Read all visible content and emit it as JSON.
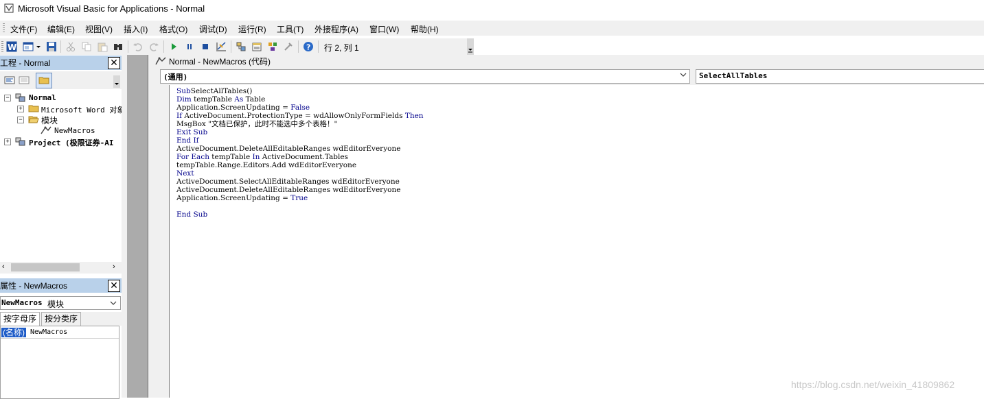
{
  "window": {
    "title": "Microsoft Visual Basic for Applications - Normal"
  },
  "menu": [
    "文件(F)",
    "编辑(E)",
    "视图(V)",
    "插入(I)",
    "格式(O)",
    "调试(D)",
    "运行(R)",
    "工具(T)",
    "外接程序(A)",
    "窗口(W)",
    "帮助(H)"
  ],
  "toolbar": {
    "icons": [
      "word-icon",
      "insert-userform-icon",
      "save-icon",
      "cut-icon",
      "copy-icon",
      "paste-icon",
      "find-icon",
      "undo-icon",
      "redo-icon",
      "run-icon",
      "break-icon",
      "reset-icon",
      "design-mode-icon",
      "project-explorer-icon",
      "properties-window-icon",
      "object-browser-icon",
      "toolbox-icon",
      "help-icon"
    ],
    "position": "行 2, 列 1"
  },
  "project": {
    "title": "工程 - Normal",
    "tree": {
      "root": "Normal",
      "word_objects": "Microsoft Word 对象",
      "modules": "模块",
      "module": "NewMacros",
      "project2": "Project (极限证券-AI"
    }
  },
  "properties": {
    "title": "属性 - NewMacros",
    "object_bold": "NewMacros",
    "object_type": " 模块",
    "tabs": [
      "按字母序",
      "按分类序"
    ],
    "row": {
      "name": "(名称)",
      "value": "NewMacros"
    }
  },
  "code_window": {
    "title": "Normal - NewMacros (代码)",
    "object_combo": "(通用)",
    "proc_combo": "SelectAllTables",
    "lines": [
      [
        [
          "kw",
          "Sub"
        ],
        [
          "",
          "SelectAllTables()"
        ]
      ],
      [
        [
          "kw",
          "Dim"
        ],
        [
          "",
          " tempTable "
        ],
        [
          "kw",
          "As"
        ],
        [
          "",
          " Table"
        ]
      ],
      [
        [
          "",
          "Application.ScreenUpdating = "
        ],
        [
          "kw",
          "False"
        ]
      ],
      [
        [
          "kw",
          "If"
        ],
        [
          "",
          " ActiveDocument.ProtectionType = wdAllowOnlyFormFields "
        ],
        [
          "kw",
          "Then"
        ]
      ],
      [
        [
          "",
          "MsgBox \"文档已保护，此时不能选中多个表格！\""
        ]
      ],
      [
        [
          "kw",
          "Exit Sub"
        ]
      ],
      [
        [
          "kw",
          "End If"
        ]
      ],
      [
        [
          "",
          "ActiveDocument.DeleteAllEditableRanges wdEditorEveryone"
        ]
      ],
      [
        [
          "kw",
          "For Each"
        ],
        [
          "",
          " tempTable "
        ],
        [
          "kw",
          "In"
        ],
        [
          "",
          " ActiveDocument.Tables"
        ]
      ],
      [
        [
          "",
          "tempTable.Range.Editors.Add wdEditorEveryone"
        ]
      ],
      [
        [
          "kw",
          "Next"
        ]
      ],
      [
        [
          "",
          "ActiveDocument.SelectAllEditableRanges wdEditorEveryone"
        ]
      ],
      [
        [
          "",
          "ActiveDocument.DeleteAllEditableRanges wdEditorEveryone"
        ]
      ],
      [
        [
          "",
          "Application.ScreenUpdating = "
        ],
        [
          "kw",
          "True"
        ]
      ],
      [],
      [
        [
          "kw",
          "End Sub"
        ]
      ]
    ]
  },
  "watermark": "https://blog.csdn.net/weixin_41809862"
}
